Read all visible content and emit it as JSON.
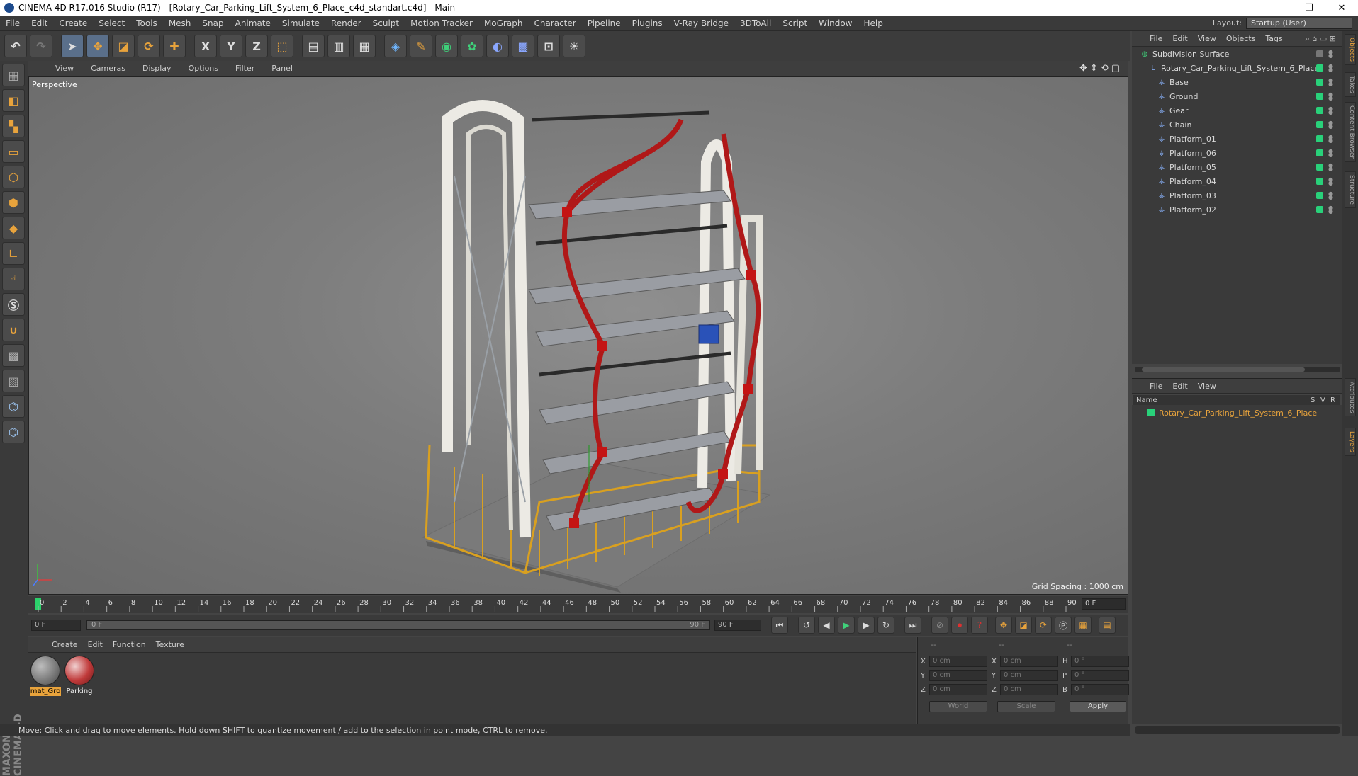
{
  "window": {
    "title": "CINEMA 4D R17.016 Studio (R17) - [Rotary_Car_Parking_Lift_System_6_Place_c4d_standart.c4d] - Main",
    "controls": [
      "—",
      "❐",
      "✕"
    ]
  },
  "menu": [
    "File",
    "Edit",
    "Create",
    "Select",
    "Tools",
    "Mesh",
    "Snap",
    "Animate",
    "Simulate",
    "Render",
    "Sculpt",
    "Motion Tracker",
    "MoGraph",
    "Character",
    "Pipeline",
    "Plugins",
    "V-Ray Bridge",
    "3DToAll",
    "Script",
    "Window",
    "Help"
  ],
  "layout": {
    "label": "Layout:",
    "value": "Startup (User)"
  },
  "toolbar": {
    "axis": [
      "X",
      "Y",
      "Z"
    ]
  },
  "viewport": {
    "menu": [
      "View",
      "Cameras",
      "Display",
      "Options",
      "Filter",
      "Panel"
    ],
    "label": "Perspective",
    "grid_spacing": "Grid Spacing : 1000 cm",
    "nav_icons": "✥⇕⟲▢"
  },
  "timeline": {
    "ticks": [
      "0",
      "2",
      "4",
      "6",
      "8",
      "10",
      "12",
      "14",
      "16",
      "18",
      "20",
      "22",
      "24",
      "26",
      "28",
      "30",
      "32",
      "34",
      "36",
      "38",
      "40",
      "42",
      "44",
      "46",
      "48",
      "50",
      "52",
      "54",
      "56",
      "58",
      "60",
      "62",
      "64",
      "66",
      "68",
      "70",
      "72",
      "74",
      "76",
      "78",
      "80",
      "82",
      "84",
      "86",
      "88",
      "90"
    ],
    "current": "0 F"
  },
  "playback": {
    "start": "0 F",
    "slider_start": "0 F",
    "slider_end": "90 F",
    "end": "90 F"
  },
  "material_menu": [
    "Create",
    "Edit",
    "Function",
    "Texture"
  ],
  "materials": [
    {
      "label": "mat_Gro",
      "color": "#8a8a8a"
    },
    {
      "label": "Parking",
      "color": "#c03a3a"
    }
  ],
  "coords": {
    "headers": [
      "--",
      "--",
      "--"
    ],
    "rows": [
      {
        "a": "X",
        "av": "0 cm",
        "b": "X",
        "bv": "0 cm",
        "c": "H",
        "cv": "0 °"
      },
      {
        "a": "Y",
        "av": "0 cm",
        "b": "Y",
        "bv": "0 cm",
        "c": "P",
        "cv": "0 °"
      },
      {
        "a": "Z",
        "av": "0 cm",
        "b": "Z",
        "bv": "0 cm",
        "c": "B",
        "cv": "0 °"
      }
    ],
    "mode1": "World",
    "mode2": "Scale",
    "apply": "Apply"
  },
  "status": "Move: Click and drag to move elements. Hold down SHIFT to quantize movement / add to the selection in point mode, CTRL to remove.",
  "objects": {
    "menu": [
      "File",
      "Edit",
      "View",
      "Objects",
      "Tags"
    ],
    "items": [
      {
        "name": "Subdivision Surface",
        "indent": 0,
        "icon": "◍"
      },
      {
        "name": "Rotary_Car_Parking_Lift_System_6_Place",
        "indent": 1,
        "icon": "L"
      },
      {
        "name": "Base",
        "indent": 2,
        "icon": "⚶"
      },
      {
        "name": "Ground",
        "indent": 2,
        "icon": "⚶"
      },
      {
        "name": "Gear",
        "indent": 2,
        "icon": "⚶"
      },
      {
        "name": "Chain",
        "indent": 2,
        "icon": "⚶"
      },
      {
        "name": "Platform_01",
        "indent": 2,
        "icon": "⚶"
      },
      {
        "name": "Platform_06",
        "indent": 2,
        "icon": "⚶"
      },
      {
        "name": "Platform_05",
        "indent": 2,
        "icon": "⚶"
      },
      {
        "name": "Platform_04",
        "indent": 2,
        "icon": "⚶"
      },
      {
        "name": "Platform_03",
        "indent": 2,
        "icon": "⚶"
      },
      {
        "name": "Platform_02",
        "indent": 2,
        "icon": "⚶"
      }
    ]
  },
  "layers": {
    "menu": [
      "File",
      "Edit",
      "View"
    ],
    "cols": [
      "Name",
      "S",
      "V",
      "R"
    ],
    "item": "Rotary_Car_Parking_Lift_System_6_Place"
  },
  "sidetabs": [
    "Objects",
    "Takes",
    "Content Browser",
    "Structure",
    "Attributes",
    "Layers"
  ],
  "maxon": "MAXON CINEMA 4D"
}
